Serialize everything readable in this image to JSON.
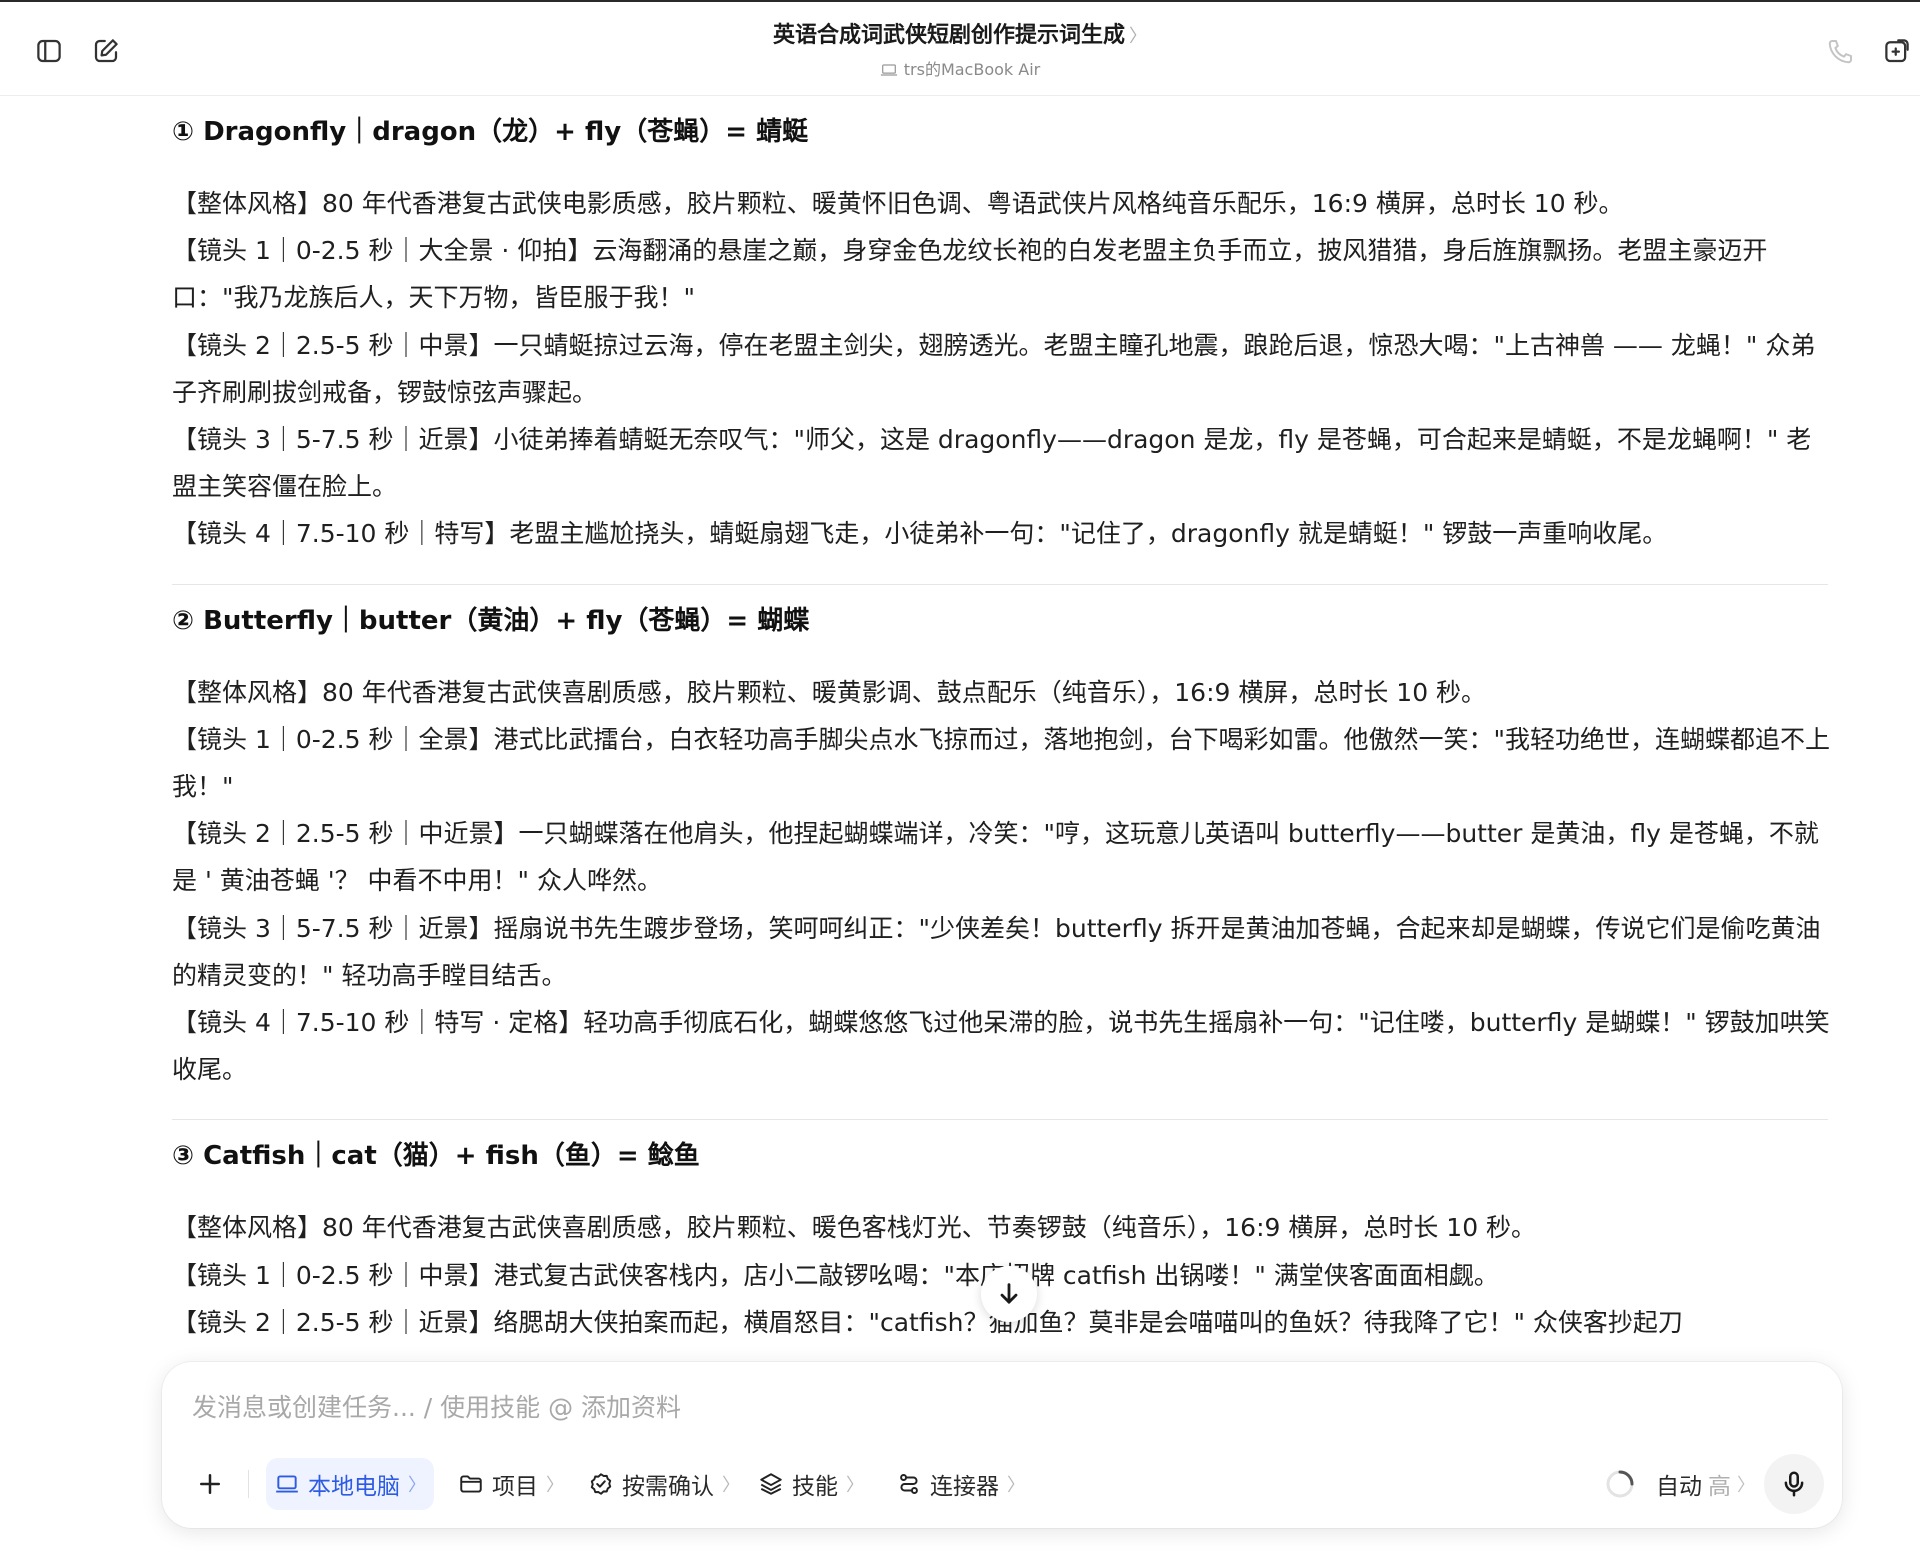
{
  "header": {
    "title": "英语合成词武侠短剧创作提示词生成",
    "title_chevron": "〉",
    "device": "trs的MacBook Air"
  },
  "sections": [
    {
      "title": "① Dragonfly｜dragon（龙）+ fly（苍蝇）= 蜻蜓",
      "paragraphs": [
        "【整体风格】80 年代香港复古武侠电影质感，胶片颗粒、暖黄怀旧色调、粤语武侠片风格纯音乐配乐，16:9 横屏，总时长 10 秒。",
        "【镜头 1｜0-2.5 秒｜大全景 · 仰拍】云海翻涌的悬崖之巅，身穿金色龙纹长袍的白发老盟主负手而立，披风猎猎，身后旌旗飘扬。老盟主豪迈开口：\"我乃龙族后人，天下万物，皆臣服于我！\"",
        "【镜头 2｜2.5-5 秒｜中景】一只蜻蜓掠过云海，停在老盟主剑尖，翅膀透光。老盟主瞳孔地震，踉跄后退，惊恐大喝：\"上古神兽 —— 龙蝇！\" 众弟子齐刷刷拔剑戒备，锣鼓惊弦声骤起。",
        "【镜头 3｜5-7.5 秒｜近景】小徒弟捧着蜻蜓无奈叹气：\"师父，这是 dragonfly——dragon 是龙，fly 是苍蝇，可合起来是蜻蜓，不是龙蝇啊！\" 老盟主笑容僵在脸上。",
        "【镜头 4｜7.5-10 秒｜特写】老盟主尴尬挠头，蜻蜓扇翅飞走，小徒弟补一句：\"记住了，dragonfly 就是蜻蜓！\" 锣鼓一声重响收尾。"
      ]
    },
    {
      "title": "② Butterfly｜butter（黄油）+ fly（苍蝇）= 蝴蝶",
      "paragraphs": [
        "【整体风格】80 年代香港复古武侠喜剧质感，胶片颗粒、暖黄影调、鼓点配乐（纯音乐），16:9 横屏，总时长 10 秒。",
        "【镜头 1｜0-2.5 秒｜全景】港式比武擂台，白衣轻功高手脚尖点水飞掠而过，落地抱剑，台下喝彩如雷。他傲然一笑：\"我轻功绝世，连蝴蝶都追不上我！\"",
        "【镜头 2｜2.5-5 秒｜中近景】一只蝴蝶落在他肩头，他捏起蝴蝶端详，冷笑：\"哼，这玩意儿英语叫 butterfly——butter 是黄油，fly 是苍蝇，不就是 ' 黄油苍蝇 '？ 中看不中用！\" 众人哗然。",
        "【镜头 3｜5-7.5 秒｜近景】摇扇说书先生踱步登场，笑呵呵纠正：\"少侠差矣！butterfly 拆开是黄油加苍蝇，合起来却是蝴蝶，传说它们是偷吃黄油的精灵变的！\" 轻功高手瞠目结舌。",
        "【镜头 4｜7.5-10 秒｜特写 · 定格】轻功高手彻底石化，蝴蝶悠悠飞过他呆滞的脸，说书先生摇扇补一句：\"记住喽，butterfly 是蝴蝶！\" 锣鼓加哄笑收尾。"
      ]
    },
    {
      "title": "③ Catfish｜cat（猫）+ fish（鱼）= 鲶鱼",
      "paragraphs": [
        "【整体风格】80 年代香港复古武侠喜剧质感，胶片颗粒、暖色客栈灯光、节奏锣鼓（纯音乐），16:9 横屏，总时长 10 秒。",
        "【镜头 1｜0-2.5 秒｜中景】港式复古武侠客栈内，店小二敲锣吆喝：\"本店招牌 catfish 出锅喽！\" 满堂侠客面面相觑。",
        "【镜头 2｜2.5-5 秒｜近景】络腮胡大侠拍案而起，横眉怒目：\"catfish？猫加鱼？莫非是会喵喵叫的鱼妖？待我降了它！\" 众侠客抄起刀"
      ]
    }
  ],
  "composer": {
    "placeholder": "发消息或创建任务... / 使用技能 @ 添加资料",
    "tools": {
      "local": "本地电脑",
      "project": "项目",
      "confirm": "按需确认",
      "skills": "技能",
      "connectors": "连接器"
    },
    "chevron": "〉",
    "mode": "自动",
    "level": "高"
  }
}
